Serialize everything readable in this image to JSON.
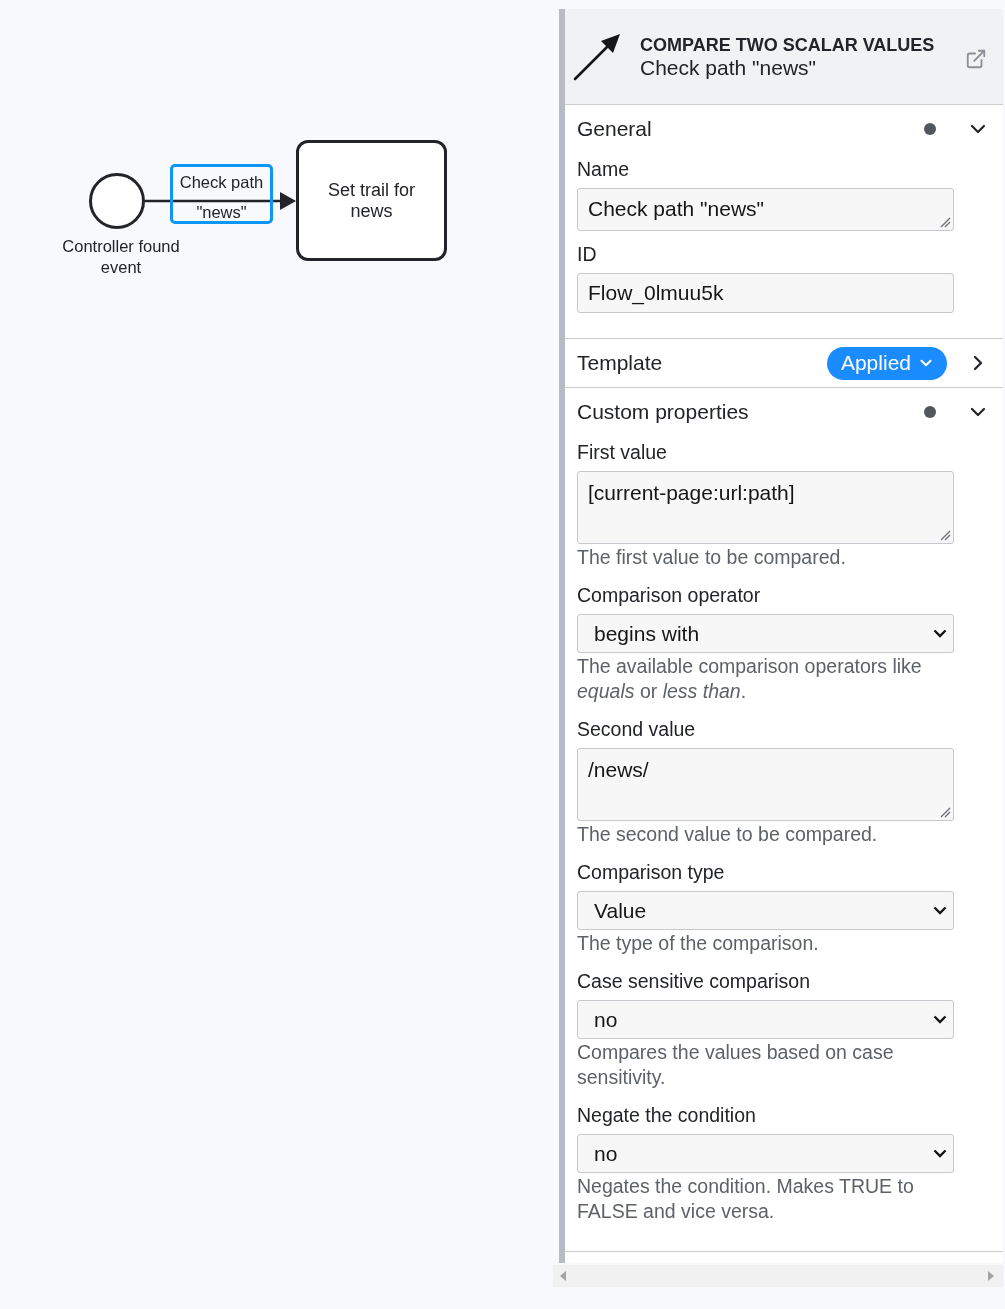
{
  "diagram": {
    "start_event": {
      "label": "Controller found event"
    },
    "sequence_flow": {
      "label": "Check path \"news\"",
      "selected": true
    },
    "task": {
      "label": "Set trail for news"
    }
  },
  "properties_panel": {
    "header": {
      "type": "COMPARE TWO SCALAR VALUES",
      "name": "Check path \"news\""
    },
    "groups": [
      {
        "title": "General",
        "has_data": true,
        "expanded": true,
        "entries": [
          {
            "kind": "textarea",
            "label": "Name",
            "value": "Check path \"news\""
          },
          {
            "kind": "text",
            "label": "ID",
            "value": "Flow_0lmuu5k"
          }
        ]
      },
      {
        "title": "Template",
        "badge": "Applied",
        "expanded": false
      },
      {
        "title": "Custom properties",
        "has_data": true,
        "expanded": true,
        "entries": [
          {
            "kind": "multiline",
            "label": "First value",
            "value": "[current-page:url:path]",
            "description": "The first value to be compared."
          },
          {
            "kind": "select",
            "label": "Comparison operator",
            "value": "begins with",
            "description": "The available comparison operators like *equals* or *less than*."
          },
          {
            "kind": "multiline",
            "label": "Second value",
            "value": "/news/",
            "description": "The second value to be compared."
          },
          {
            "kind": "select",
            "label": "Comparison type",
            "value": "Value",
            "description": "The type of the comparison."
          },
          {
            "kind": "select",
            "label": "Case sensitive comparison",
            "value": "no",
            "description": "Compares the values based on case sensitivity."
          },
          {
            "kind": "select",
            "label": "Negate the condition",
            "value": "no",
            "description": "Negates the condition. Makes TRUE to FALSE and vice versa."
          }
        ]
      }
    ]
  }
}
